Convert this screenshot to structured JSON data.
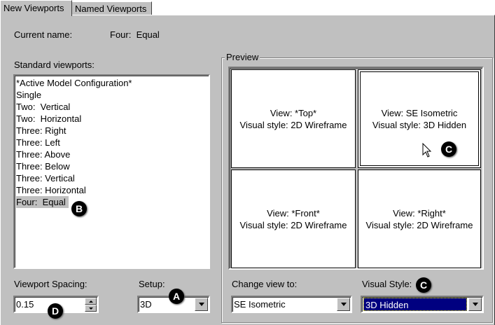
{
  "tabs": [
    {
      "label": "New Viewports"
    },
    {
      "label": "Named Viewports"
    }
  ],
  "current_name": {
    "label": "Current name:",
    "value": "Four:  Equal"
  },
  "standard": {
    "label": "Standard viewports:",
    "items": [
      "*Active Model Configuration*",
      "Single",
      "Two:  Vertical",
      "Two:  Horizontal",
      "Three: Right",
      "Three: Left",
      "Three: Above",
      "Three: Below",
      "Three: Vertical",
      "Three: Horizontal",
      "Four:  Equal"
    ],
    "selected": "Four:  Equal"
  },
  "preview": {
    "label": "Preview",
    "cells": [
      {
        "view": "View: *Top*",
        "style": "Visual style: 2D Wireframe"
      },
      {
        "view": "View: SE Isometric",
        "style": "Visual style: 3D Hidden"
      },
      {
        "view": "View: *Front*",
        "style": "Visual style: 2D Wireframe"
      },
      {
        "view": "View: *Right*",
        "style": "Visual style: 2D Wireframe"
      }
    ]
  },
  "spacing": {
    "label": "Viewport Spacing:",
    "value": "0.15"
  },
  "setup": {
    "label": "Setup:",
    "value": "3D"
  },
  "change_view": {
    "label": "Change view to:",
    "value": "SE Isometric"
  },
  "visual_style": {
    "label": "Visual Style:",
    "value": "3D Hidden"
  },
  "badges": {
    "a": "A",
    "b": "B",
    "c": "C",
    "d": "D"
  }
}
